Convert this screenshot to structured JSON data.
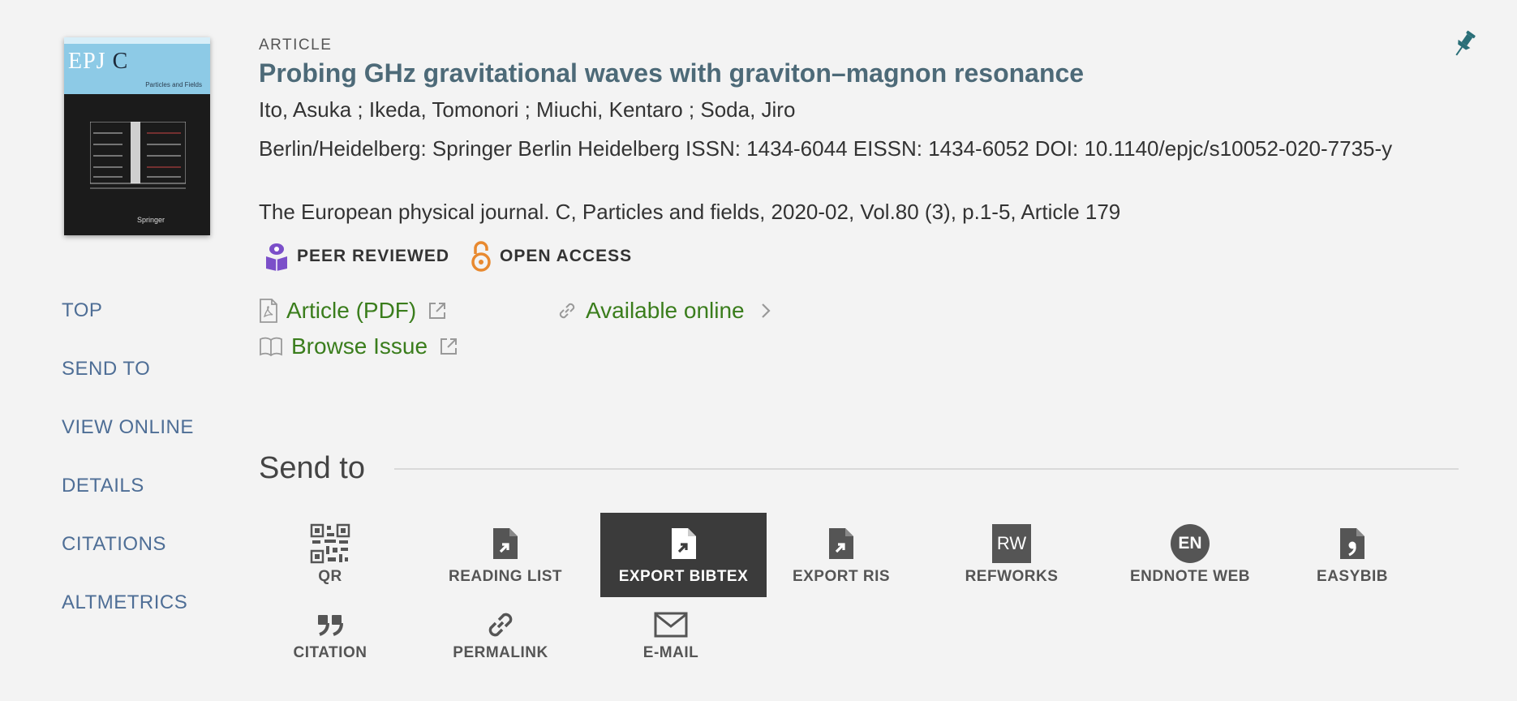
{
  "cover": {
    "journal_abbrev_a": "EPJ",
    "journal_abbrev_b": "C",
    "subtitle": "Particles and Fields",
    "publisher_mark": "Springer"
  },
  "record": {
    "type": "ARTICLE",
    "title": "Probing GHz gravitational waves with graviton–magnon resonance",
    "authors": "Ito, Asuka ; Ikeda, Tomonori ; Miuchi, Kentaro ; Soda, Jiro",
    "publication_info": "Berlin/Heidelberg: Springer Berlin Heidelberg ISSN: 1434-6044 EISSN: 1434-6052 DOI: 10.1140/epjc/s10052-020-7735-y",
    "journal": "The European physical journal. C, Particles and fields, 2020-02, Vol.80 (3), p.1-5, Article 179"
  },
  "badges": {
    "peer_reviewed": "PEER REVIEWED",
    "open_access": "OPEN ACCESS"
  },
  "links": {
    "article_pdf": "Article (PDF)",
    "browse_issue": "Browse Issue",
    "available_online": "Available online"
  },
  "sidebar": {
    "items": [
      "TOP",
      "SEND TO",
      "VIEW ONLINE",
      "DETAILS",
      "CITATIONS",
      "ALTMETRICS"
    ]
  },
  "send_to": {
    "title": "Send to",
    "actions": [
      {
        "label": "QR",
        "icon": "qr-code-icon"
      },
      {
        "label": "READING LIST",
        "icon": "reading-list-icon"
      },
      {
        "label": "EXPORT BIBTEX",
        "icon": "export-bibtex-icon",
        "selected": true
      },
      {
        "label": "EXPORT RIS",
        "icon": "export-ris-icon"
      },
      {
        "label": "REFWORKS",
        "icon": "refworks-icon",
        "icon_text": "RW"
      },
      {
        "label": "ENDNOTE WEB",
        "icon": "endnote-icon",
        "icon_text": "EN"
      },
      {
        "label": "EASYBIB",
        "icon": "easybib-icon"
      },
      {
        "label": "CITATION",
        "icon": "quote-icon"
      },
      {
        "label": "PERMALINK",
        "icon": "link-icon"
      },
      {
        "label": "E-MAIL",
        "icon": "mail-icon"
      }
    ]
  },
  "colors": {
    "title": "#4d6a78",
    "link_green": "#3a7d1c",
    "sidebar_blue": "#4e6e96",
    "peer_reviewed_purple": "#7b4fc9",
    "open_access_orange": "#e8892f",
    "pin_teal": "#2a6f78",
    "selected_bg": "#3b3b3b"
  }
}
